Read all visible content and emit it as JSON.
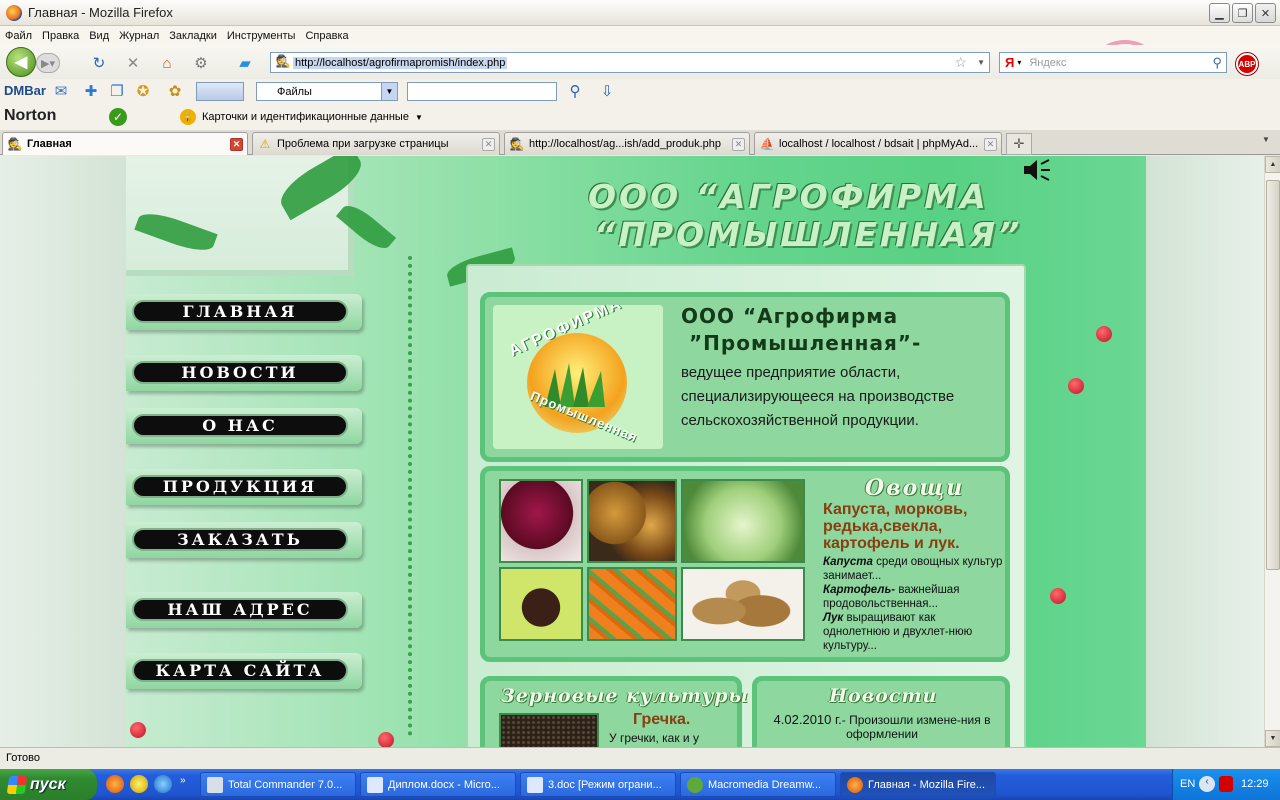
{
  "window": {
    "title": "Главная - Mozilla Firefox"
  },
  "menubar": [
    "Файл",
    "Правка",
    "Вид",
    "Журнал",
    "Закладки",
    "Инструменты",
    "Справка"
  ],
  "nav": {
    "url": "http://localhost/agrofirmapromish/index.php",
    "search_engine": "Я",
    "search_placeholder": "Яндекс"
  },
  "toolbar": {
    "dmbar": "DMBar",
    "files_select": "Файлы",
    "norton": "Norton",
    "cards": "Карточки и идентификационные данные"
  },
  "tabs": [
    {
      "label": "Главная",
      "active": true
    },
    {
      "label": "Проблема при загрузке страницы",
      "active": false
    },
    {
      "label": "http://localhost/ag...ish/add_produk.php",
      "active": false
    },
    {
      "label": "localhost / localhost / bdsait | phpMyAd...",
      "active": false
    }
  ],
  "site": {
    "title_line1": "ООО “АГРОФИРМА",
    "title_line2": "“ПРОМЫШЛЕННАЯ”",
    "menu": [
      "ГЛАВНАЯ",
      "НОВОСТИ",
      "О НАС",
      "ПРОДУКЦИЯ",
      "ЗАКАЗАТЬ",
      "НАШ АДРЕС",
      "КАРТА САЙТА"
    ],
    "logo_top": "АГРОФИРМА",
    "logo_bottom": "Промышленная",
    "intro": {
      "title_line1": "ООО “Агрофирма",
      "title_line2": "”Промышленная”-",
      "text": "ведущее предприятие области, специализирующееся на производстве сельскохозяйственной продукции."
    },
    "vegetables": {
      "heading": "Овощи",
      "subtitle": "Капуста, морковь, редька,свекла, картофель и лук.",
      "text1_label": "Капуста",
      "text1": "среди овощных культур занимает...",
      "text2_label": "Картофель-",
      "text2": "важнейшая продовольственная...",
      "text3_label": "Лук",
      "text3": "выращивают как однолетнюю и двухлет-нюю культуру..."
    },
    "grain": {
      "heading": "Зерновые культуры",
      "subtitle": "Гречка.",
      "text": "У гречки, как и у"
    },
    "news": {
      "heading": "Новости",
      "date": "4.02.2010 г.",
      "text": "- Произошли измене-ния в оформлении"
    }
  },
  "status": "Готово",
  "taskbar": {
    "start": "пуск",
    "tasks": [
      "Total Commander 7.0...",
      "Диплом.docx - Micro...",
      "3.doc [Режим ограни...",
      "Macromedia Dreamw...",
      "Главная - Mozilla Fire..."
    ],
    "lang": "EN",
    "clock": "12:29"
  }
}
